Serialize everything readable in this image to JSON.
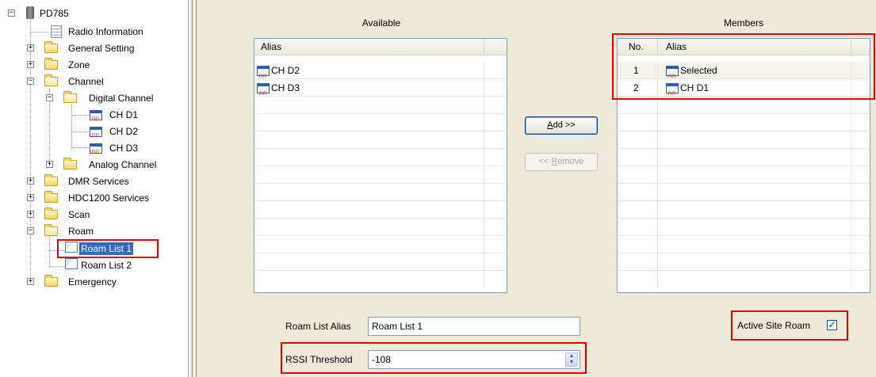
{
  "tree": {
    "root": "PD785",
    "radio_info": "Radio Information",
    "general_setting": "General Setting",
    "zone": "Zone",
    "channel": "Channel",
    "digital_channel": "Digital Channel",
    "ch_d1": "CH D1",
    "ch_d2": "CH D2",
    "ch_d3": "CH D3",
    "analog_channel": "Analog Channel",
    "dmr_services": "DMR Services",
    "hdc1200_services": "HDC1200 Services",
    "scan": "Scan",
    "roam": "Roam",
    "roam_list_1": "Roam List 1",
    "roam_list_2": "Roam List 2",
    "emergency": "Emergency"
  },
  "available": {
    "caption": "Available",
    "col_alias": "Alias",
    "rows": [
      "CH D2",
      "CH D3"
    ]
  },
  "members": {
    "caption": "Members",
    "col_no": "No.",
    "col_alias": "Alias",
    "rows": [
      {
        "no": "1",
        "alias": "Selected"
      },
      {
        "no": "2",
        "alias": "CH D1"
      }
    ]
  },
  "buttons": {
    "add": "Add >>",
    "add_mnemonic": "A",
    "add_rest": "dd >>",
    "remove_pre": "<< ",
    "remove_mnemonic": "R",
    "remove_rest": "emove"
  },
  "form": {
    "roam_list_alias_label": "Roam List Alias",
    "roam_list_alias_value": "Roam List 1",
    "rssi_label": "RSSI Threshold",
    "rssi_value": "-108",
    "active_site_roam_label": "Active Site Roam",
    "active_site_roam_checked": true
  },
  "colors": {
    "highlight": "#e00000",
    "selection": "#316ac5"
  }
}
